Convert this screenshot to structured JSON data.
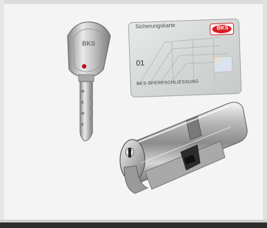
{
  "card": {
    "title": "Sicherungskarte",
    "number": "01",
    "footer": "BKS-SPERRSCHLIESSUNG",
    "brand": "BKS"
  },
  "key": {
    "brand": "BKS"
  },
  "colors": {
    "brand_red": "#d71f26",
    "background": "#f4f4f4"
  }
}
